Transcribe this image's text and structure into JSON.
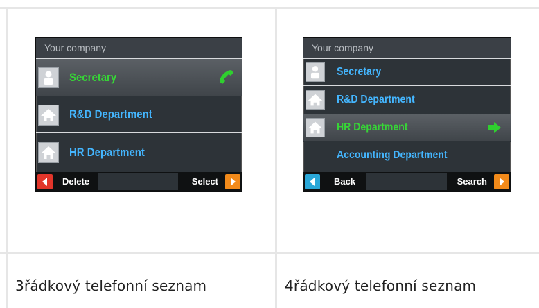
{
  "left": {
    "title": "Your company",
    "rows": [
      {
        "label": "Secretary",
        "icon": "person-icon",
        "selected": true
      },
      {
        "label": "R&D Department",
        "icon": "home-icon",
        "selected": false
      },
      {
        "label": "HR Department",
        "icon": "home-icon",
        "selected": false
      }
    ],
    "softkeys": {
      "left": "Delete",
      "right": "Select"
    },
    "caption": "3řádkový telefonní seznam"
  },
  "right": {
    "title": "Your company",
    "rows": [
      {
        "label": "Secretary",
        "icon": "person-icon",
        "selected": false
      },
      {
        "label": "R&D Department",
        "icon": "home-icon",
        "selected": false
      },
      {
        "label": "HR Department",
        "icon": "home-icon",
        "selected": true
      },
      {
        "label": "Accounting Department",
        "icon": "",
        "selected": false
      }
    ],
    "softkeys": {
      "left": "Back",
      "right": "Search"
    },
    "caption": "4řádkový telefonní seznam"
  },
  "colors": {
    "selected_text": "#37d437",
    "normal_text": "#44b6ff",
    "left_key_red": "#e2352a",
    "left_key_teal": "#2aa7d8",
    "right_key_orange": "#f28a1a"
  }
}
